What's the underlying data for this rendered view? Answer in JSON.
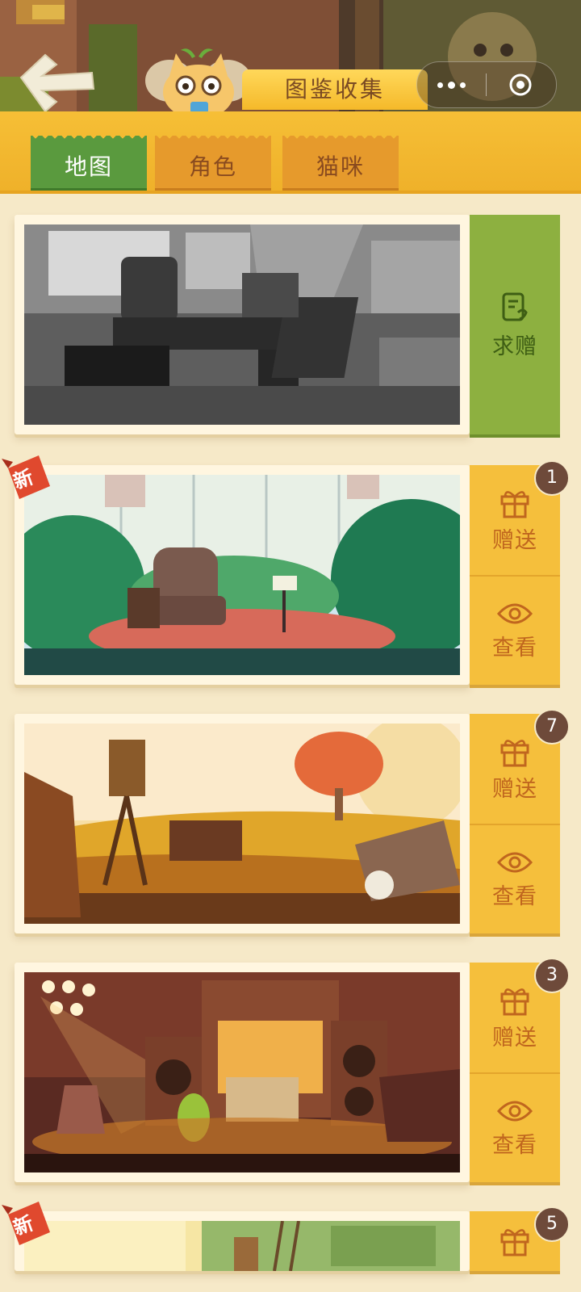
{
  "header": {
    "title": "图鉴收集",
    "back_icon": "back-arrow-icon",
    "more_icon": "more-dots-icon",
    "close_icon": "target-close-icon"
  },
  "tabs": [
    {
      "label": "地图",
      "active": true
    },
    {
      "label": "角色",
      "active": false
    },
    {
      "label": "猫咪",
      "active": false
    }
  ],
  "cards": [
    {
      "scene": "office-grayscale",
      "badge": null,
      "new": false,
      "actions": [
        {
          "icon": "request-icon",
          "label": "求赠"
        }
      ]
    },
    {
      "scene": "greenhouse-armchair",
      "badge": "1",
      "new": true,
      "new_label": "新",
      "actions": [
        {
          "icon": "gift-icon",
          "label": "赠送"
        },
        {
          "icon": "eye-icon",
          "label": "查看"
        }
      ]
    },
    {
      "scene": "wheat-field-camera",
      "badge": "7",
      "new": false,
      "actions": [
        {
          "icon": "gift-icon",
          "label": "赠送"
        },
        {
          "icon": "eye-icon",
          "label": "查看"
        }
      ]
    },
    {
      "scene": "concert-stage",
      "badge": "3",
      "new": false,
      "actions": [
        {
          "icon": "gift-icon",
          "label": "赠送"
        },
        {
          "icon": "eye-icon",
          "label": "查看"
        }
      ]
    },
    {
      "scene": "sunny-room",
      "badge": "5",
      "new": true,
      "new_label": "新",
      "actions": [
        {
          "icon": "gift-icon",
          "label": ""
        }
      ]
    }
  ],
  "colors": {
    "background": "#f6e9c8",
    "tab_active": "#5a9a3e",
    "tab_inactive": "#e69a2c",
    "side_green": "#8db040",
    "side_yellow": "#f5bf3c",
    "badge": "#6e4a3a",
    "new_tag": "#e0492e"
  }
}
